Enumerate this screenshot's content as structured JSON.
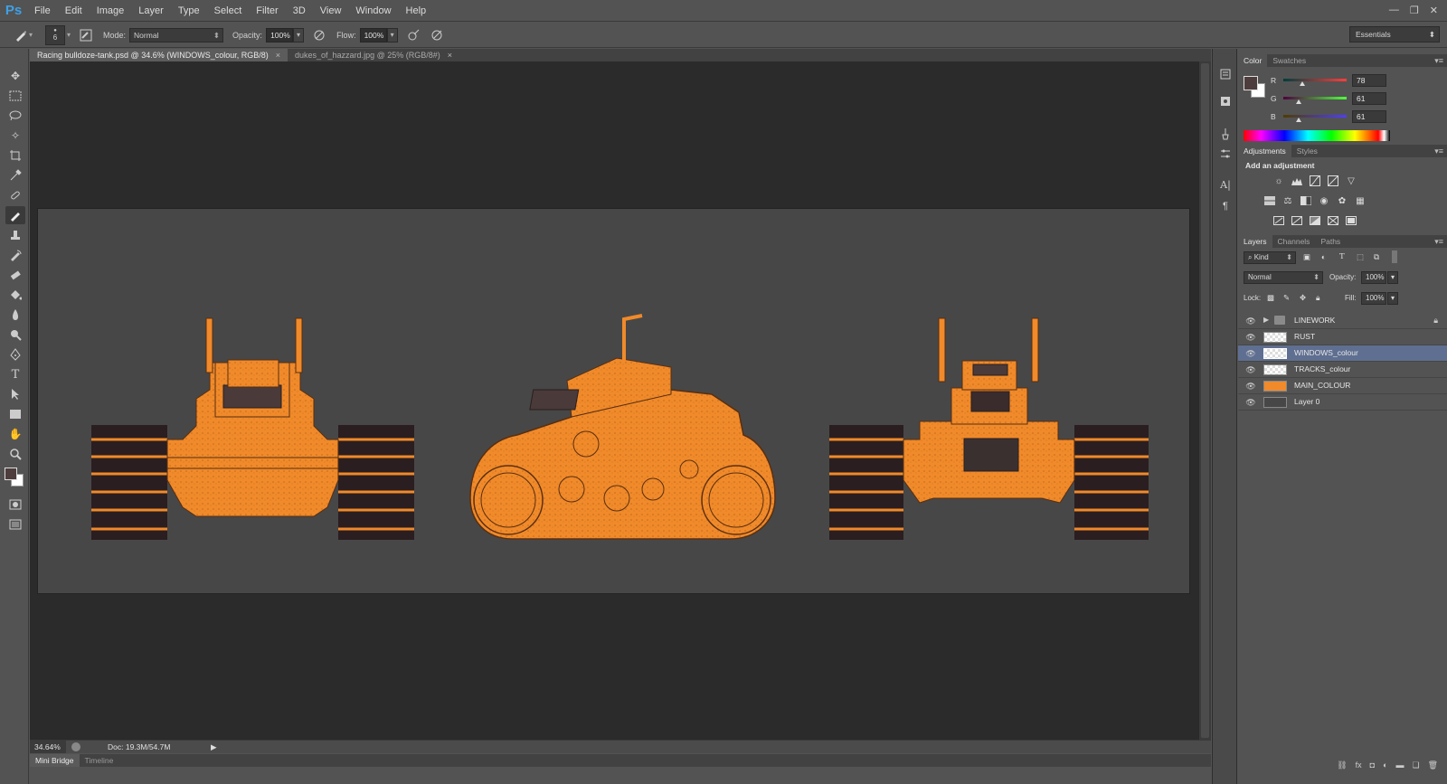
{
  "app": {
    "logo": "Ps"
  },
  "menu": [
    "File",
    "Edit",
    "Image",
    "Layer",
    "Type",
    "Select",
    "Filter",
    "3D",
    "View",
    "Window",
    "Help"
  ],
  "window_controls": {
    "minimize": "—",
    "restore": "❐",
    "close": "✕"
  },
  "options": {
    "brush_size": "6",
    "mode_label": "Mode:",
    "mode_value": "Normal",
    "opacity_label": "Opacity:",
    "opacity_value": "100%",
    "flow_label": "Flow:",
    "flow_value": "100%",
    "workspace": "Essentials"
  },
  "tabs": [
    {
      "label": "Racing bulldoze-tank.psd @ 34.6% (WINDOWS_colour, RGB/8)",
      "close": "×"
    },
    {
      "label": "dukes_of_hazzard.jpg @ 25% (RGB/8#)",
      "close": "×"
    }
  ],
  "status": {
    "zoom": "34.64%",
    "doc": "Doc: 19.3M/54.7M"
  },
  "bottom_tabs": [
    "Mini Bridge",
    "Timeline"
  ],
  "color_panel": {
    "tabs": [
      "Color",
      "Swatches"
    ],
    "fg_color": "#4e3d3d",
    "bg_color": "#ffffff",
    "r_label": "R",
    "g_label": "G",
    "b_label": "B",
    "r": "78",
    "g": "61",
    "b": "61",
    "r_level": 0.306,
    "g_level": 0.239,
    "b_level": 0.239
  },
  "adjust_panel": {
    "tabs": [
      "Adjustments",
      "Styles"
    ],
    "title": "Add an adjustment"
  },
  "layers_panel": {
    "tabs": [
      "Layers",
      "Channels",
      "Paths"
    ],
    "kind": "Kind",
    "blend": "Normal",
    "opacity_label": "Opacity:",
    "opacity": "100%",
    "lock_label": "Lock:",
    "fill_label": "Fill:",
    "fill": "100%",
    "layers": [
      {
        "name": "LINEWORK",
        "type": "group",
        "locked": true
      },
      {
        "name": "RUST"
      },
      {
        "name": "WINDOWS_colour",
        "selected": true
      },
      {
        "name": "TRACKS_colour"
      },
      {
        "name": "MAIN_COLOUR"
      },
      {
        "name": "Layer 0"
      }
    ]
  },
  "colors": {
    "vehicle_orange": "#f08a2a",
    "track_dark": "#2a1e20",
    "selection": "#5f6f91"
  }
}
